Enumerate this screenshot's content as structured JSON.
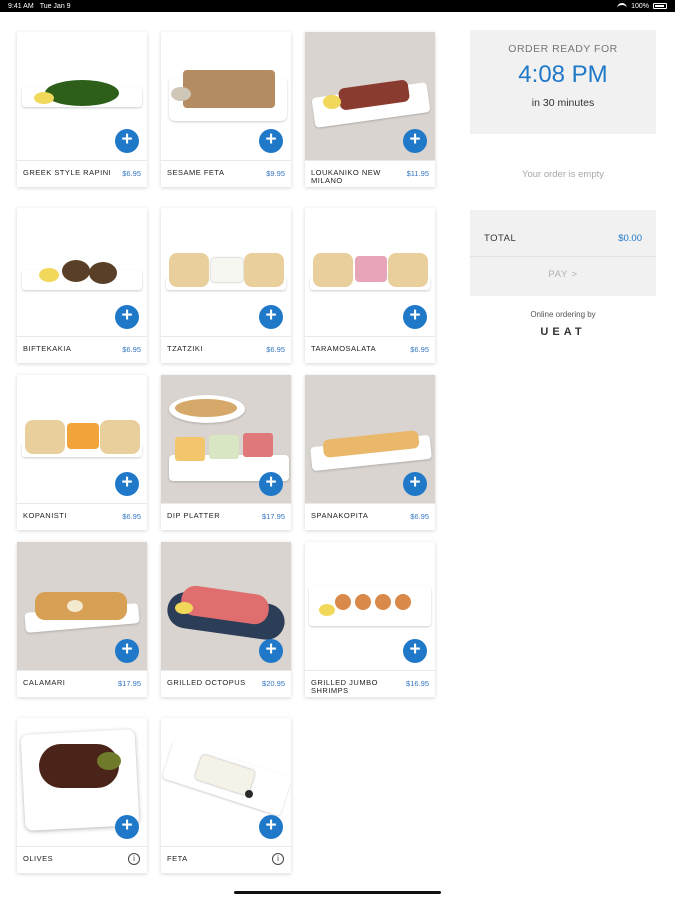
{
  "status": {
    "time": "9:41 AM",
    "date": "Tue Jan 9",
    "battery": "100%"
  },
  "menu": {
    "items": [
      {
        "name": "GREEK STYLE RAPINI",
        "price": "$6.95",
        "action": "add",
        "photo_background": "white"
      },
      {
        "name": "SESAME FETA",
        "price": "$9.95",
        "action": "add",
        "photo_background": "white"
      },
      {
        "name": "LOUKANIKO NEW MILANO",
        "price": "$11.95",
        "action": "add",
        "photo_background": "grey"
      },
      {
        "name": "BIFTEKAKIA",
        "price": "$6.95",
        "action": "add",
        "photo_background": "white"
      },
      {
        "name": "TZATZIKI",
        "price": "$6.95",
        "action": "add",
        "photo_background": "white"
      },
      {
        "name": "TARAMOSALATA",
        "price": "$6.95",
        "action": "add",
        "photo_background": "white"
      },
      {
        "name": "KOPANISTI",
        "price": "$6.95",
        "action": "add",
        "photo_background": "white"
      },
      {
        "name": "DIP PLATTER",
        "price": "$17.95",
        "action": "add",
        "photo_background": "grey"
      },
      {
        "name": "SPANAKOPITA",
        "price": "$6.95",
        "action": "add",
        "photo_background": "grey"
      },
      {
        "name": "CALAMARI",
        "price": "$17.95",
        "action": "add",
        "photo_background": "grey"
      },
      {
        "name": "GRILLED OCTOPUS",
        "price": "$20.95",
        "action": "add",
        "photo_background": "grey"
      },
      {
        "name": "GRILLED JUMBO SHRIMPS",
        "price": "$16.95",
        "action": "add",
        "photo_background": "white"
      },
      {
        "name": "OLIVES",
        "price": "",
        "action": "info",
        "photo_background": "white"
      },
      {
        "name": "FETA",
        "price": "",
        "action": "info",
        "photo_background": "white"
      }
    ],
    "add_icon_glyph": "+",
    "info_icon_glyph": "i"
  },
  "order": {
    "ready_label": "ORDER READY FOR",
    "ready_time": "4:08 PM",
    "ready_sub": "in 30 minutes",
    "empty_message": "Your order is empty",
    "total_label": "TOTAL",
    "total_value": "$0.00",
    "pay_label": "PAY  >",
    "powered_by": "Online ordering by",
    "brand": "UEAT"
  },
  "colors": {
    "accent": "#1f78c8",
    "price": "#3677c3",
    "panel": "#f1f1f1",
    "muted": "#a8a8a8"
  }
}
